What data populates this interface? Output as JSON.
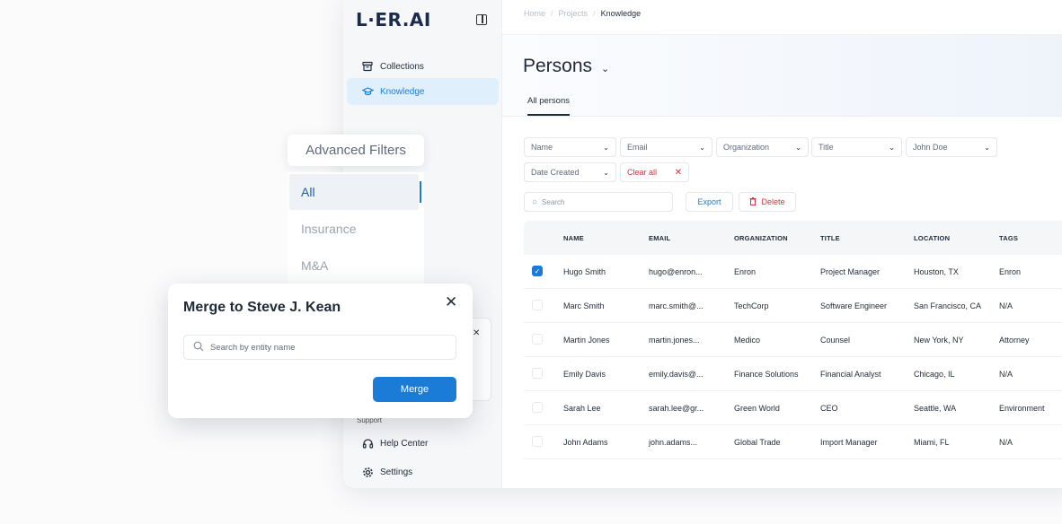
{
  "app": {
    "logo": "L·ER.AI"
  },
  "sidebar": {
    "items": [
      {
        "label": "Collections",
        "icon": "archive-icon"
      },
      {
        "label": "Knowledge",
        "icon": "graduation-cap-icon"
      }
    ],
    "support_label": "Support",
    "bottom_items": [
      {
        "label": "Help Center",
        "icon": "headset-icon"
      },
      {
        "label": "Settings",
        "icon": "gear-icon"
      }
    ]
  },
  "breadcrumb": {
    "items": [
      "Home",
      "Projects",
      "Knowledge"
    ]
  },
  "page": {
    "title": "Persons",
    "tab": "All persons"
  },
  "filters": {
    "name": "Name",
    "email": "Email",
    "organization": "Organization",
    "title": "Title",
    "person": "John Doe",
    "date_created": "Date Created",
    "clear_all": "Clear all"
  },
  "toolbar": {
    "search_placeholder": "Search",
    "export": "Export",
    "delete": "Delete"
  },
  "table": {
    "columns": [
      "NAME",
      "EMAIL",
      "ORGANIZATION",
      "TITLE",
      "LOCATION",
      "TAGS"
    ],
    "rows": [
      {
        "checked": true,
        "name": "Hugo Smith",
        "email": "hugo@enron...",
        "org": "Enron",
        "title": "Project Manager",
        "location": "Houston, TX",
        "tags": "Enron"
      },
      {
        "checked": false,
        "name": "Marc Smith",
        "email": "marc.smith@...",
        "org": "TechCorp",
        "title": "Software Engineer",
        "location": "San Francisco, CA",
        "tags": "N/A"
      },
      {
        "checked": false,
        "name": "Martin Jones",
        "email": "martin.jones...",
        "org": "Medico",
        "title": "Counsel",
        "location": "New York, NY",
        "tags": "Attorney"
      },
      {
        "checked": false,
        "name": "Emily Davis",
        "email": "emily.davis@...",
        "org": "Finance Solutions",
        "title": "Financial Analyst",
        "location": "Chicago, IL",
        "tags": "N/A"
      },
      {
        "checked": false,
        "name": "Sarah Lee",
        "email": "sarah.lee@gr...",
        "org": "Green World",
        "title": "CEO",
        "location": "Seattle, WA",
        "tags": "Environment"
      },
      {
        "checked": false,
        "name": "John Adams",
        "email": "john.adams...",
        "org": "Global Trade",
        "title": "Import Manager",
        "location": "Miami, FL",
        "tags": "N/A"
      }
    ]
  },
  "advanced_filters": {
    "title": "Advanced Filters",
    "items": [
      "All",
      "Insurance",
      "M&A"
    ]
  },
  "merge_dialog": {
    "title": "Merge to Steve J. Kean",
    "search_placeholder": "Search by entity name",
    "merge_label": "Merge"
  },
  "colors": {
    "accent": "#1a7cd6",
    "danger": "#d1333a"
  }
}
